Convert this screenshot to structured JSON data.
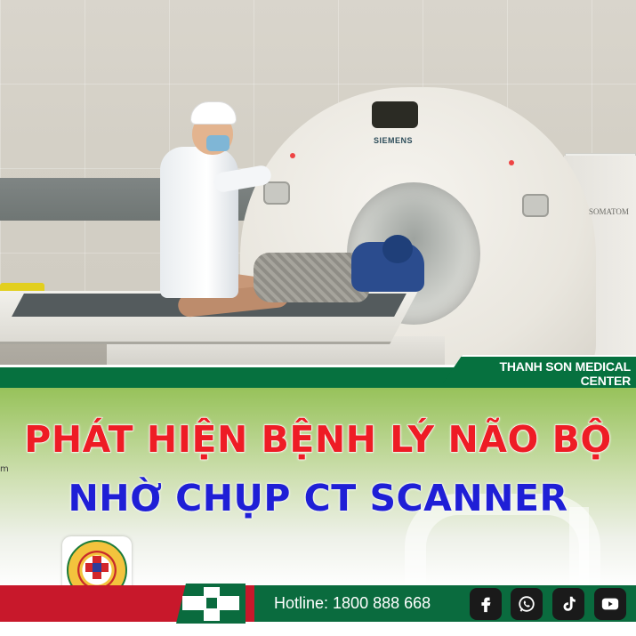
{
  "photo": {
    "gantry_brand": "SIEMENS",
    "gantry_model": "SOMATOM"
  },
  "banner": {
    "center_name": "THANH SON MEDICAL CENTER"
  },
  "headline": {
    "line1": "PHÁT HIỆN BỆNH LÝ NÃO BỘ",
    "line2": "NHỜ CHỤP CT SCANNER",
    "line1_color": "#ee1c25",
    "line2_color": "#1f1fd6"
  },
  "edge_text": "m",
  "footer": {
    "hotline": "Hotline: 1800 888 668",
    "social_icons": [
      "facebook-icon",
      "whatsapp-icon",
      "tiktok-icon",
      "youtube-icon"
    ]
  },
  "colors": {
    "brand_green": "#0a6b3e",
    "brand_red": "#c8182b",
    "panel_green": "#97c25a"
  }
}
